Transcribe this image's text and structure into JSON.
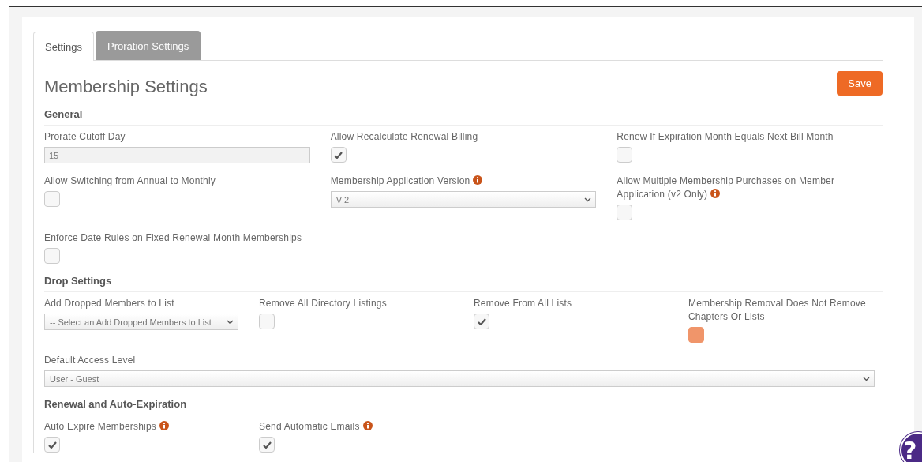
{
  "tabs": [
    {
      "label": "Settings",
      "selected": true
    },
    {
      "label": "Proration Settings",
      "selected": false
    }
  ],
  "title": "Membership Settings",
  "save_button": "Save",
  "sections": [
    {
      "heading": "General",
      "fields": [
        {
          "kind": "text",
          "label": "Prorate Cutoff Day",
          "info": false,
          "value": "15"
        },
        {
          "kind": "checkbox",
          "label": "Allow Recalculate Renewal Billing",
          "info": false,
          "checked": true,
          "highlighted": false
        },
        {
          "kind": "checkbox",
          "label": "Renew If Expiration Month Equals Next Bill Month",
          "info": false,
          "checked": false,
          "highlighted": false
        },
        {
          "kind": "checkbox",
          "label": "Allow Switching from Annual to Monthly",
          "info": false,
          "checked": false,
          "highlighted": false
        },
        {
          "kind": "select",
          "label": "Membership Application Version",
          "info": true,
          "value": "V 2"
        },
        {
          "kind": "checkbox",
          "label": "Allow Multiple Membership Purchases on Member Application (v2 Only)",
          "info": true,
          "checked": false,
          "highlighted": false
        },
        {
          "kind": "checkbox",
          "label": "Enforce Date Rules on Fixed Renewal Month Memberships",
          "info": false,
          "checked": false,
          "highlighted": false
        }
      ]
    },
    {
      "heading": "Drop Settings",
      "fields": [
        {
          "kind": "select",
          "label": "Add Dropped Members to List",
          "info": false,
          "value": "-- Select an Add Dropped Members to List"
        },
        {
          "kind": "checkbox",
          "label": "Remove All Directory Listings",
          "info": false,
          "checked": false,
          "highlighted": false
        },
        {
          "kind": "checkbox",
          "label": "Remove From All Lists",
          "info": false,
          "checked": true,
          "highlighted": false
        },
        {
          "kind": "checkbox",
          "label": "Membership Removal Does Not Remove Chapters Or Lists",
          "info": false,
          "checked": false,
          "highlighted": true
        },
        {
          "kind": "select",
          "label": "Default Access Level",
          "info": false,
          "value": "User - Guest",
          "full_width": true
        }
      ]
    },
    {
      "heading": "Renewal and Auto-Expiration",
      "fields": [
        {
          "kind": "checkbox",
          "label": "Auto Expire Memberships",
          "info": true,
          "checked": true,
          "highlighted": false
        },
        {
          "kind": "checkbox",
          "label": "Send Automatic Emails",
          "info": true,
          "checked": true,
          "highlighted": false
        }
      ]
    }
  ],
  "help_button": "?"
}
